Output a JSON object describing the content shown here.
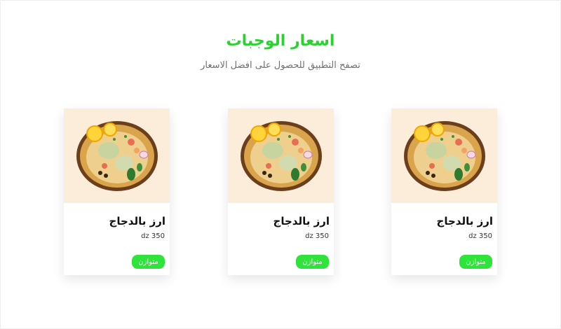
{
  "section": {
    "title": "اسعار الوجبات",
    "subtitle": "تصفح التطبيق للحصول على افضل الاسعار"
  },
  "cards": [
    {
      "name": "ارز بالدجاج",
      "price": "dz 350",
      "badge": "متوازن",
      "image_icon": "chicken-rice-dish"
    },
    {
      "name": "ارز بالدجاج",
      "price": "dz 350",
      "badge": "متوازن",
      "image_icon": "chicken-rice-dish"
    },
    {
      "name": "ارز بالدجاج",
      "price": "dz 350",
      "badge": "متوازن",
      "image_icon": "chicken-rice-dish"
    }
  ],
  "colors": {
    "accent": "#2bd130",
    "badge": "#2ee33a",
    "image_background": "#fbedd9"
  }
}
